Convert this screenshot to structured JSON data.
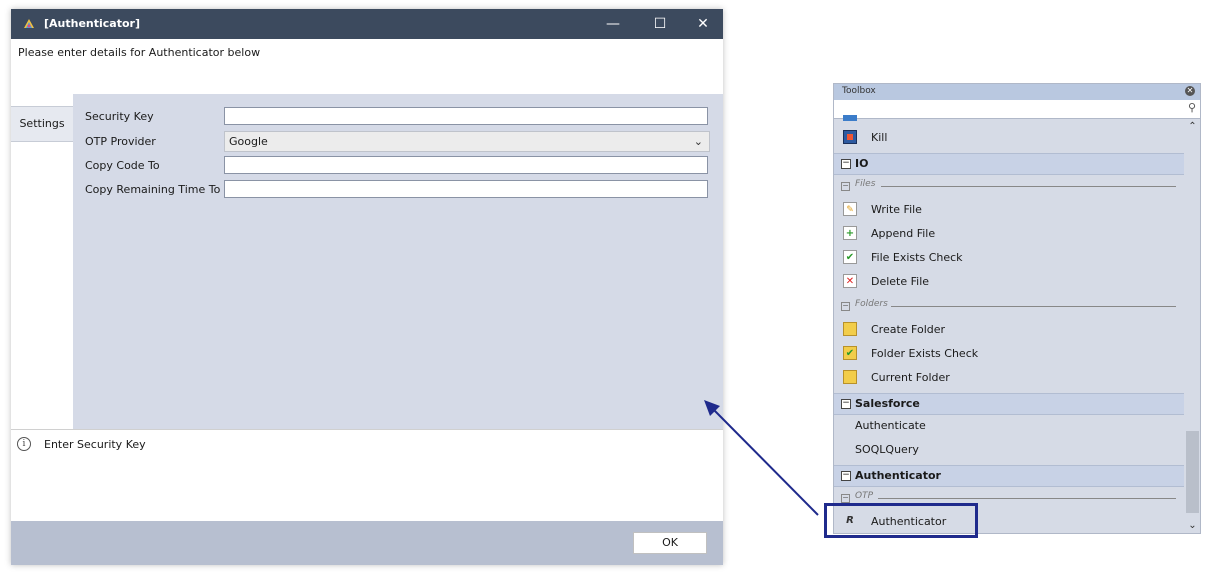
{
  "dialog": {
    "title": "[Authenticator]",
    "controls": {
      "minimize": "—",
      "maximize": "☐",
      "close": "✕"
    },
    "intro": "Please enter details for Authenticator below",
    "tabs": [
      {
        "label": "Settings"
      }
    ],
    "fields": [
      {
        "label": "Security Key",
        "value": ""
      },
      {
        "label": "OTP Provider",
        "value": "Google",
        "type": "select"
      },
      {
        "label": "Copy Code To",
        "value": ""
      },
      {
        "label": "Copy Remaining Time To",
        "value": ""
      }
    ],
    "info_text": "Enter Security Key",
    "ok_label": "OK"
  },
  "toolbox": {
    "title": "Toolbox",
    "search_placeholder": "",
    "items": {
      "kill": "Kill",
      "cat_io": "IO",
      "grp_files": "Files",
      "write_file": "Write File",
      "append_file": "Append File",
      "file_exists_check": "File Exists Check",
      "delete_file": "Delete File",
      "grp_folders": "Folders",
      "create_folder": "Create Folder",
      "folder_exists_check": "Folder Exists Check",
      "current_folder": "Current Folder",
      "cat_salesforce": "Salesforce",
      "authenticate": "Authenticate",
      "soql_query": "SOQLQuery",
      "cat_authenticator": "Authenticator",
      "grp_otp": "OTP",
      "authenticator": "Authenticator"
    }
  },
  "colors": {
    "titlebar": "#3c4a5e",
    "panel": "#d5dae7",
    "highlight": "#1f2a8c"
  }
}
